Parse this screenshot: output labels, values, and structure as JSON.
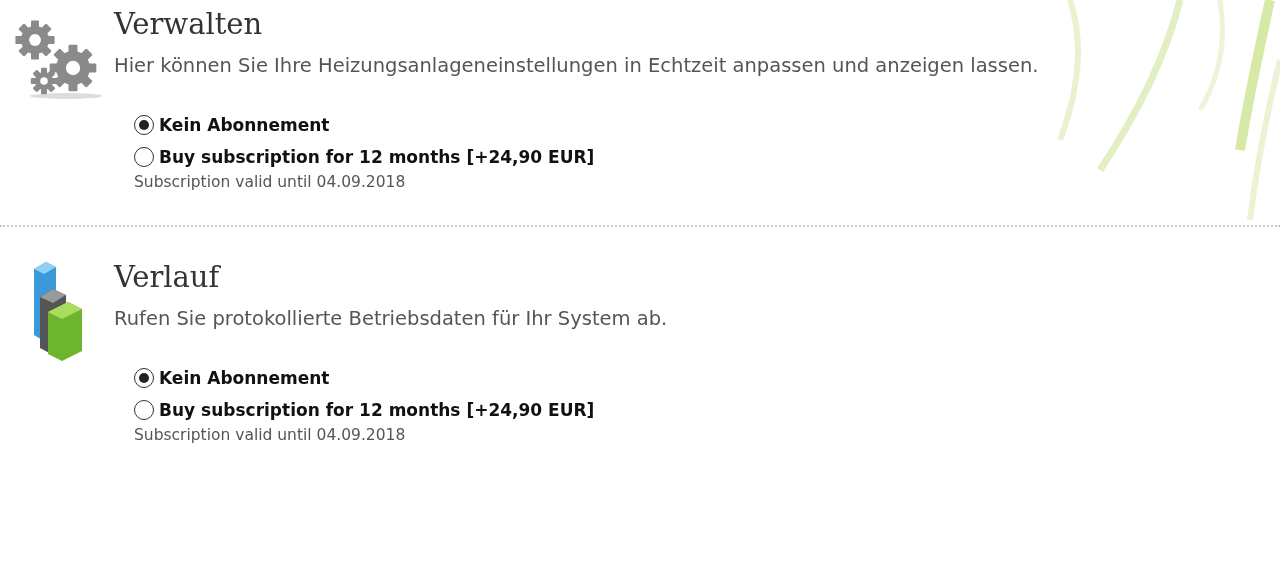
{
  "sections": [
    {
      "kind": "gears",
      "title": "Verwalten",
      "description": "Hier können Sie Ihre Heizungsanlageneinstellungen in Echtzeit anpassen und anzeigen lassen.",
      "options": [
        {
          "label": "Kein Abonnement",
          "selected": true
        },
        {
          "label": "Buy subscription for 12 months [+24,90 EUR]",
          "selected": false
        }
      ],
      "note": "Subscription valid until 04.09.2018"
    },
    {
      "kind": "chart",
      "title": "Verlauf",
      "description": "Rufen Sie protokollierte Betriebsdaten für Ihr System ab.",
      "options": [
        {
          "label": "Kein Abonnement",
          "selected": true
        },
        {
          "label": "Buy subscription for 12 months [+24,90 EUR]",
          "selected": false
        }
      ],
      "note": "Subscription valid until 04.09.2018"
    }
  ]
}
